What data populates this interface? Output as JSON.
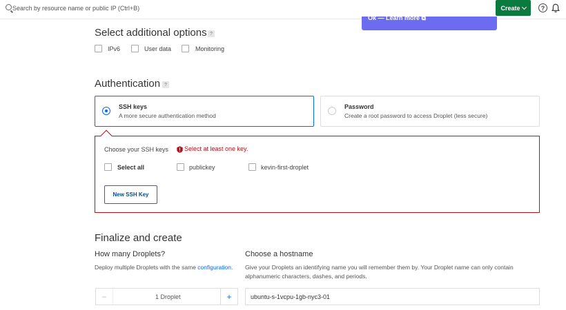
{
  "topbar": {
    "search_placeholder": "Search by resource name or public IP (Ctrl+B)",
    "create_label": "Create",
    "help_label": "?"
  },
  "banner": {
    "text": "Ok — Learn more ⧉"
  },
  "options": {
    "title": "Select additional options",
    "help": "?",
    "items": [
      "IPv6",
      "User data",
      "Monitoring"
    ]
  },
  "auth": {
    "title": "Authentication",
    "help": "?",
    "ssh": {
      "title": "SSH keys",
      "subtitle": "A more secure authentication method",
      "selected": true
    },
    "password": {
      "title": "Password",
      "subtitle": "Create a root password to access Droplet (less secure)",
      "selected": false
    },
    "choose_label": "Choose your SSH keys",
    "error": "Select at least one key.",
    "select_all": "Select all",
    "keys": [
      "publickey",
      "kevin-first-droplet"
    ],
    "new_key_button": "New SSH Key"
  },
  "finalize": {
    "title": "Finalize and create",
    "count": {
      "title": "How many Droplets?",
      "desc_prefix": "Deploy multiple Droplets with the same ",
      "desc_link": "configuration",
      "desc_suffix": ".",
      "value": "1",
      "unit": "Droplet",
      "minus": "−",
      "plus": "+"
    },
    "hostname": {
      "title": "Choose a hostname",
      "desc": "Give your Droplets an identifying name you will remember them by. Your Droplet name can only contain alphanumeric characters, dashes, and periods.",
      "value": "ubuntu-s-1vcpu-1gb-nyc3-01"
    }
  },
  "colors": {
    "accent": "#0069ff",
    "create_green": "#0a7a3e",
    "error": "#b5121b",
    "banner": "#6b6cf0"
  }
}
